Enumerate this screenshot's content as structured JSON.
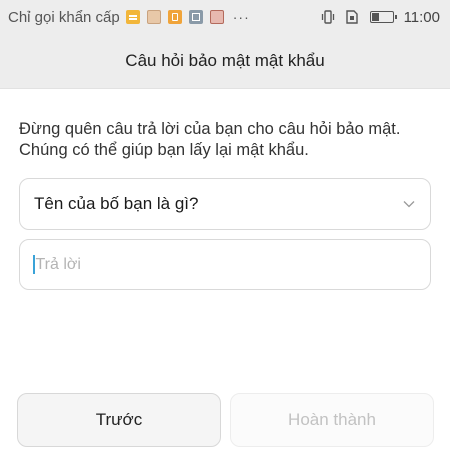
{
  "status_bar": {
    "carrier_text": "Chỉ gọi khẩn cấp",
    "more": "···",
    "time": "11:00",
    "battery_level": 0.35,
    "notification_icons": [
      "message-icon",
      "avatar-thumbnail-icon",
      "clipboard-icon",
      "gallery-icon",
      "avatar-thumbnail-icon"
    ]
  },
  "header": {
    "title": "Câu hỏi bảo mật mật khẩu"
  },
  "description": {
    "line1": "Đừng quên câu trả lời của bạn cho câu hỏi bảo mật.",
    "line2": "Chúng có thể giúp bạn lấy lại mật khẩu."
  },
  "question_select": {
    "value": "Tên của bố bạn là gì?"
  },
  "answer_input": {
    "value": "",
    "placeholder": "Trả lời"
  },
  "buttons": {
    "previous": "Trước",
    "finish": "Hoàn thành"
  },
  "colors": {
    "header_bg": "#ededed",
    "caret": "#3aa3d8",
    "disabled_text": "#c2c2c2"
  }
}
